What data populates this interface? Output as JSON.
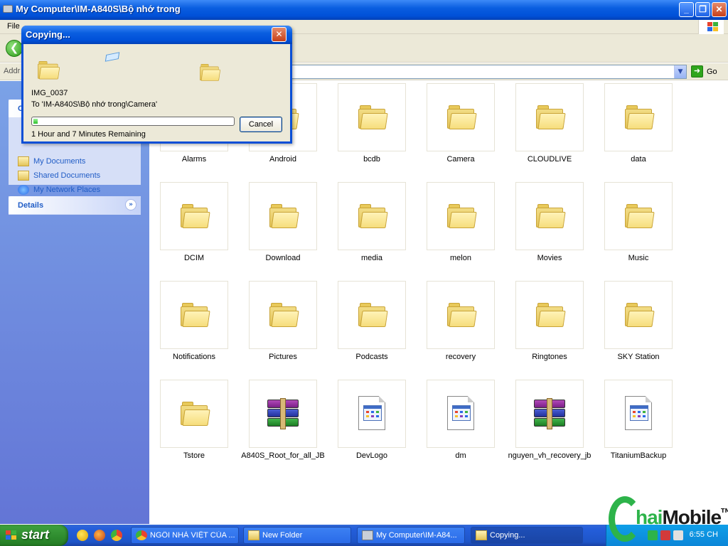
{
  "window": {
    "title": "My Computer\\IM-A840S\\Bộ nhớ trong",
    "menu_first": "File",
    "address_label": "Addr",
    "go_label": "Go"
  },
  "taskpane": {
    "places_header_initial": "O",
    "places": [
      {
        "label": "My Documents",
        "icon": "my-documents-icon"
      },
      {
        "label": "Shared Documents",
        "icon": "shared-documents-icon"
      },
      {
        "label": "My Network Places",
        "icon": "network-places-icon"
      }
    ],
    "details_header": "Details"
  },
  "items": [
    {
      "label": "Alarms",
      "type": "folder"
    },
    {
      "label": "Android",
      "type": "folder"
    },
    {
      "label": "bcdb",
      "type": "folder"
    },
    {
      "label": "Camera",
      "type": "folder"
    },
    {
      "label": "CLOUDLIVE",
      "type": "folder"
    },
    {
      "label": "data",
      "type": "folder"
    },
    {
      "label": "DCIM",
      "type": "folder"
    },
    {
      "label": "Download",
      "type": "folder"
    },
    {
      "label": "media",
      "type": "folder"
    },
    {
      "label": "melon",
      "type": "folder"
    },
    {
      "label": "Movies",
      "type": "folder"
    },
    {
      "label": "Music",
      "type": "folder"
    },
    {
      "label": "Notifications",
      "type": "folder"
    },
    {
      "label": "Pictures",
      "type": "folder"
    },
    {
      "label": "Podcasts",
      "type": "folder"
    },
    {
      "label": "recovery",
      "type": "folder"
    },
    {
      "label": "Ringtones",
      "type": "folder"
    },
    {
      "label": "SKY Station",
      "type": "folder"
    },
    {
      "label": "Tstore",
      "type": "folder"
    },
    {
      "label": "A840S_Root_for_all_JB",
      "type": "archive"
    },
    {
      "label": "DevLogo",
      "type": "document"
    },
    {
      "label": "dm",
      "type": "document"
    },
    {
      "label": "nguyen_vh_recovery_jb",
      "type": "archive"
    },
    {
      "label": "TitaniumBackup",
      "type": "document"
    }
  ],
  "dialog": {
    "title": "Copying...",
    "file": "IMG_0037",
    "destination": "To 'IM-A840S\\Bộ nhớ trong\\Camera'",
    "remaining": "1 Hour and 7 Minutes Remaining",
    "cancel_label": "Cancel",
    "progress_fraction": 0.02
  },
  "taskbar": {
    "start_label": "start",
    "buttons": [
      {
        "label": "NGÔI NHÀ VIỆT CỦA ...",
        "icon": "chrome-icon"
      },
      {
        "label": "New Folder",
        "icon": "folder-icon"
      },
      {
        "label": "My Computer\\IM-A84...",
        "icon": "device-icon"
      },
      {
        "label": "Copying...",
        "icon": "folder-icon"
      }
    ],
    "clock": "6:55 CH"
  },
  "watermark": {
    "brand_prefix": "hai",
    "brand_suffix": "Mobile",
    "tm": "TM"
  },
  "colors": {
    "xp_blue": "#0a5ee0",
    "taskpane": "#7ba2e7",
    "link": "#215dc6",
    "progress": "#2dc12a",
    "start_green": "#2e8b2e"
  }
}
